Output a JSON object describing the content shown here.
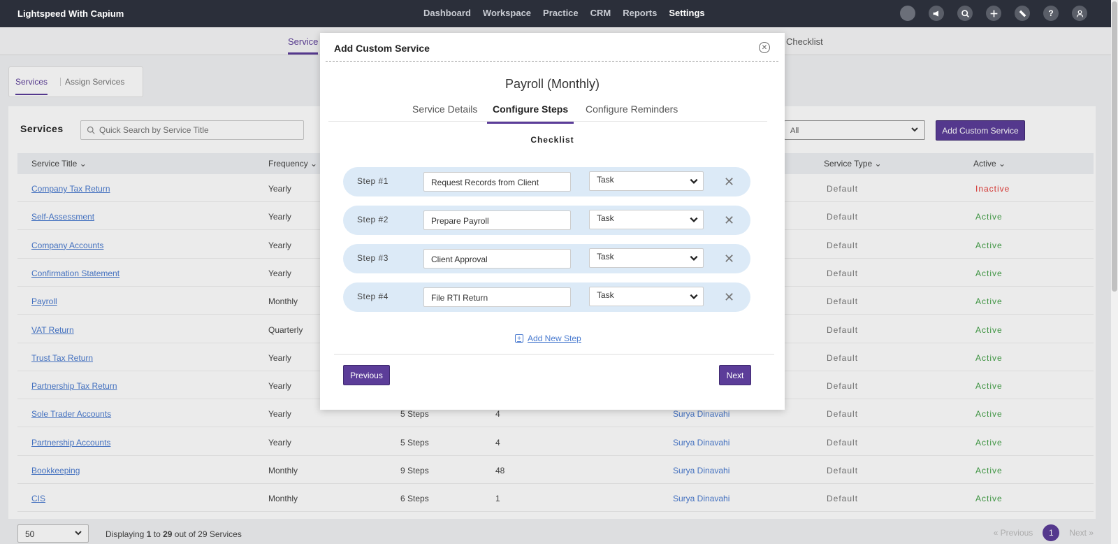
{
  "app": {
    "brand": "Lightspeed With Capium"
  },
  "nav": {
    "menu": [
      "Dashboard",
      "Workspace",
      "Practice",
      "CRM",
      "Reports",
      "Settings"
    ],
    "active": "Settings"
  },
  "subtabs": {
    "services": "Service",
    "checklist": "Checklist"
  },
  "pills": {
    "services": "Services",
    "assign": "Assign Services"
  },
  "panel": {
    "title": "Services",
    "search_placeholder": "Quick Search by Service Title",
    "filter_value": "All",
    "add_button": "Add Custom Service"
  },
  "table": {
    "headers": {
      "service_title": "Service Title",
      "frequency": "Frequency",
      "service_type": "Service Type",
      "active": "Active"
    },
    "rows": [
      {
        "title": "Company Tax Return",
        "frequency": "Yearly",
        "steps": "",
        "count": "",
        "person": "",
        "type": "Default",
        "status": "Inactive"
      },
      {
        "title": "Self-Assessment",
        "frequency": "Yearly",
        "steps": "",
        "count": "",
        "person": "",
        "type": "Default",
        "status": "Active"
      },
      {
        "title": "Company Accounts",
        "frequency": "Yearly",
        "steps": "",
        "count": "",
        "person": "",
        "type": "Default",
        "status": "Active"
      },
      {
        "title": "Confirmation Statement",
        "frequency": "Yearly",
        "steps": "",
        "count": "",
        "person": "",
        "type": "Default",
        "status": "Active"
      },
      {
        "title": "Payroll",
        "frequency": "Monthly",
        "steps": "",
        "count": "",
        "person": "",
        "type": "Default",
        "status": "Active"
      },
      {
        "title": "VAT Return",
        "frequency": "Quarterly",
        "steps": "",
        "count": "",
        "person": "",
        "type": "Default",
        "status": "Active"
      },
      {
        "title": "Trust Tax Return",
        "frequency": "Yearly",
        "steps": "",
        "count": "",
        "person": "",
        "type": "Default",
        "status": "Active"
      },
      {
        "title": "Partnership Tax Return",
        "frequency": "Yearly",
        "steps": "",
        "count": "",
        "person": "",
        "type": "Default",
        "status": "Active"
      },
      {
        "title": "Sole Trader Accounts",
        "frequency": "Yearly",
        "steps": "5 Steps",
        "count": "4",
        "person": "Surya Dinavahi",
        "type": "Default",
        "status": "Active"
      },
      {
        "title": "Partnership Accounts",
        "frequency": "Yearly",
        "steps": "5 Steps",
        "count": "4",
        "person": "Surya Dinavahi",
        "type": "Default",
        "status": "Active"
      },
      {
        "title": "Bookkeeping",
        "frequency": "Monthly",
        "steps": "9 Steps",
        "count": "48",
        "person": "Surya Dinavahi",
        "type": "Default",
        "status": "Active"
      },
      {
        "title": "CIS",
        "frequency": "Monthly",
        "steps": "6 Steps",
        "count": "1",
        "person": "Surya Dinavahi",
        "type": "Default",
        "status": "Active"
      }
    ]
  },
  "footer": {
    "page_size": "50",
    "displaying_prefix": "Displaying",
    "from": "1",
    "to_word": "to",
    "to": "29",
    "out_of": "out of 29 Services",
    "previous": "«  Previous",
    "page": "1",
    "next": "Next  »"
  },
  "modal": {
    "title": "Add Custom Service",
    "service_name": "Payroll (Monthly)",
    "tabs": [
      "Service Details",
      "Configure Steps",
      "Configure Reminders"
    ],
    "active_tab": "Configure Steps",
    "section_label": "Checklist",
    "steps": [
      {
        "label": "Step #1",
        "value": "Request Records from Client",
        "type": "Task"
      },
      {
        "label": "Step #2",
        "value": "Prepare Payroll",
        "type": "Task"
      },
      {
        "label": "Step #3",
        "value": "Client Approval",
        "type": "Task"
      },
      {
        "label": "Step #4",
        "value": "File RTI Return",
        "type": "Task"
      }
    ],
    "add_step": "Add New Step",
    "previous": "Previous",
    "next": "Next"
  },
  "colors": {
    "accent": "#5c3d99",
    "nav_bg": "#2b2f3a",
    "link": "#4a7bd0",
    "active": "#43a047",
    "inactive": "#e53935",
    "step_bg": "#dceaf7"
  }
}
